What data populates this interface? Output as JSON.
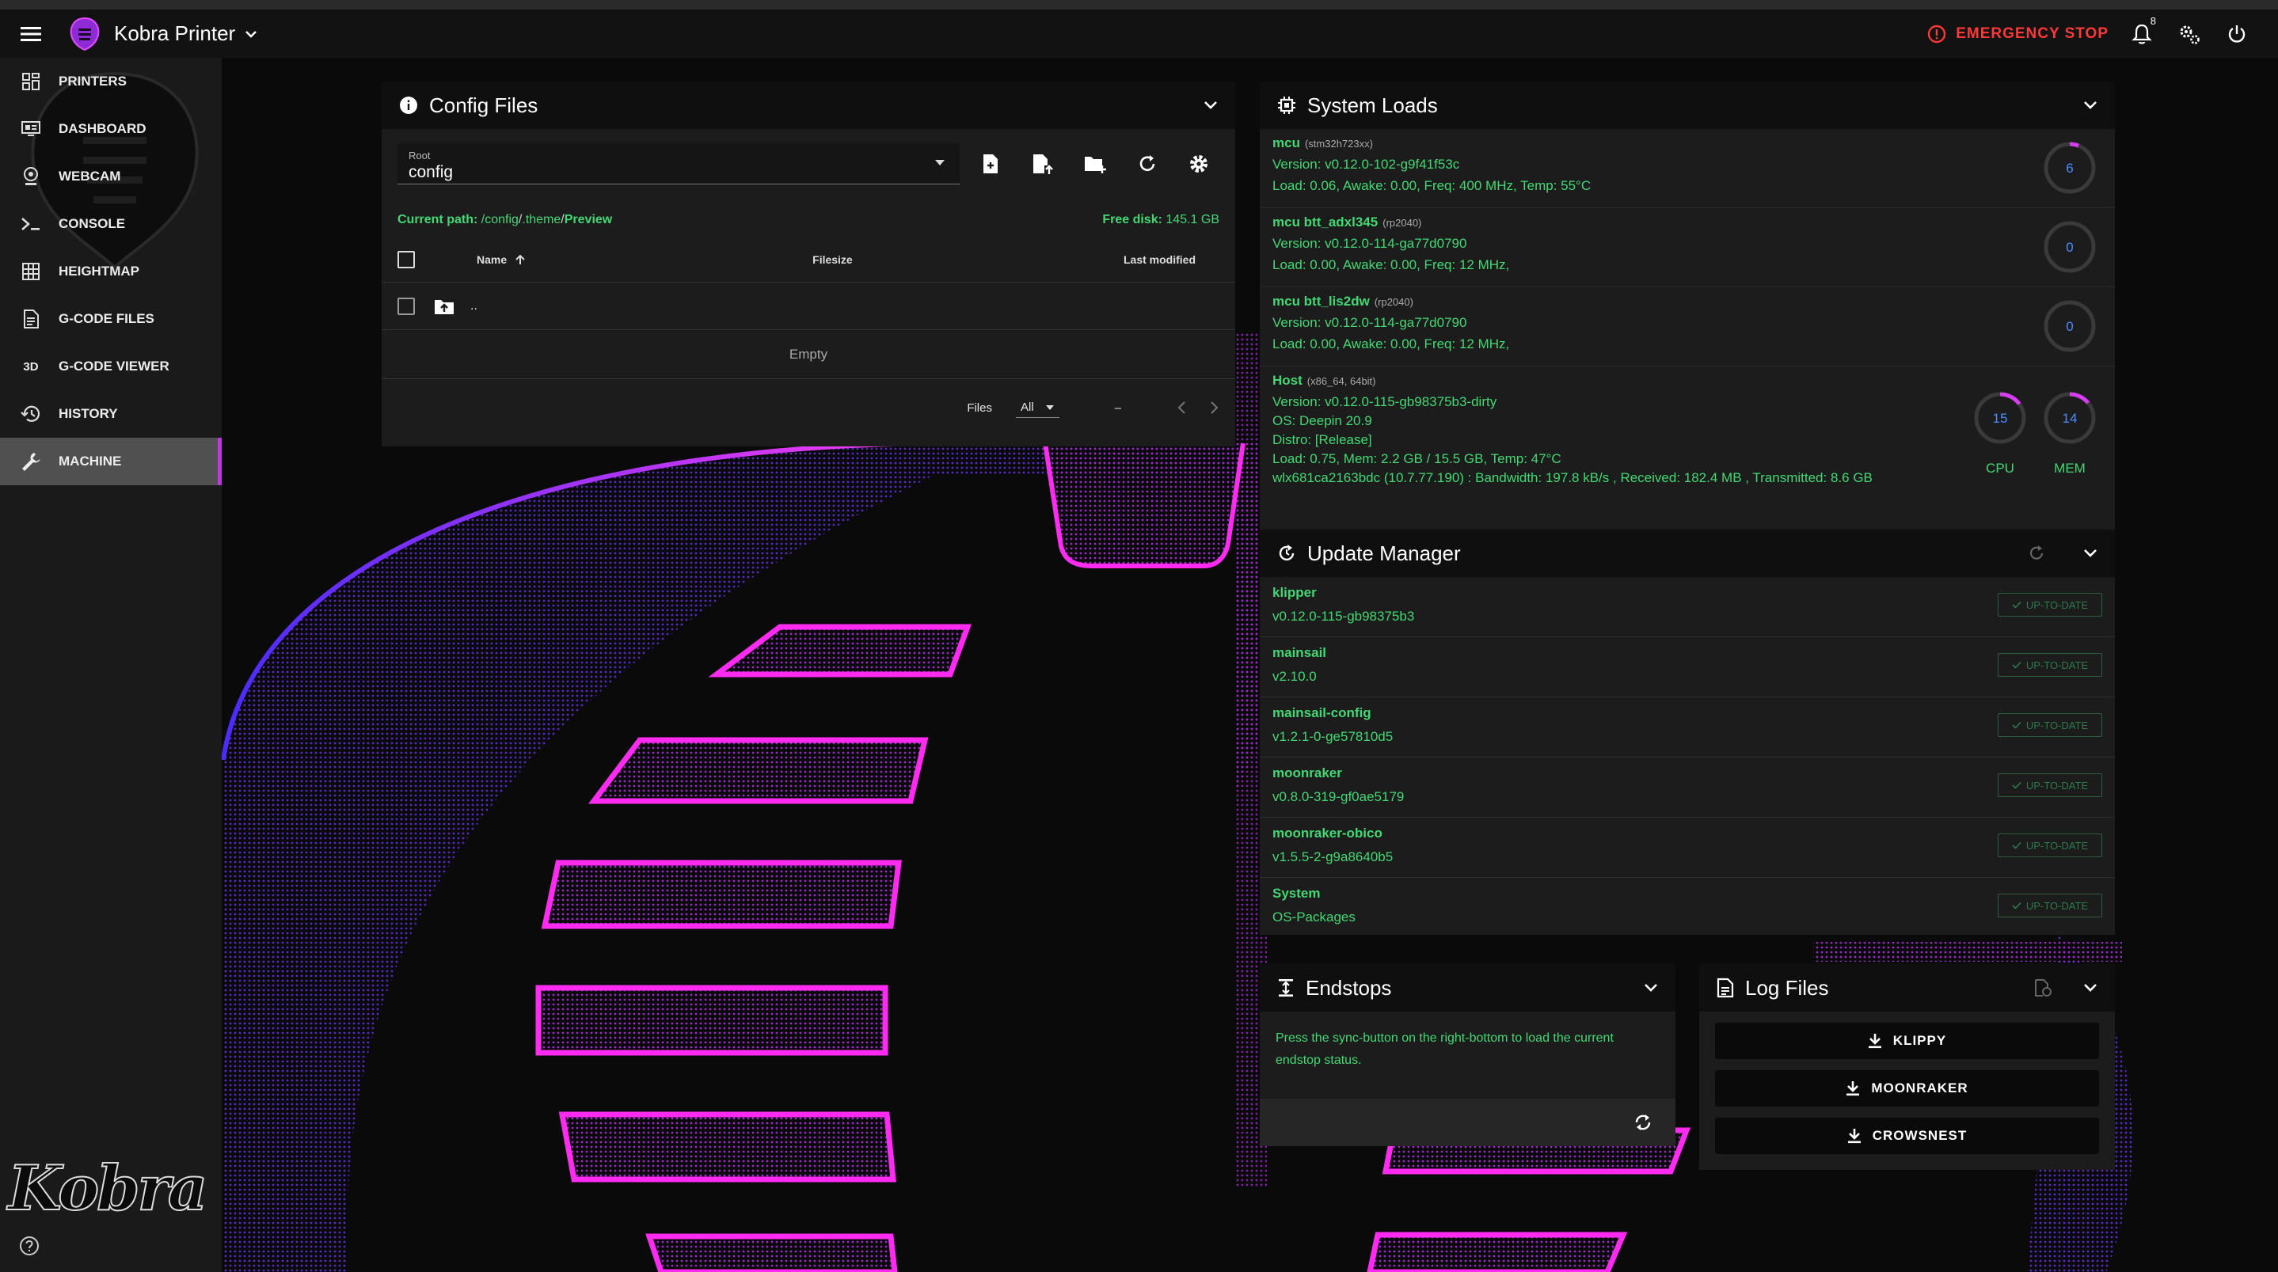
{
  "app": {
    "title": "Kobra Printer"
  },
  "topbar": {
    "emergency_stop": "EMERGENCY STOP",
    "notifications_count": "8"
  },
  "sidebar": {
    "items": [
      {
        "label": "PRINTERS",
        "icon": "grid-icon"
      },
      {
        "label": "DASHBOARD",
        "icon": "dashboard-icon"
      },
      {
        "label": "WEBCAM",
        "icon": "webcam-icon"
      },
      {
        "label": "CONSOLE",
        "icon": "console-icon"
      },
      {
        "label": "HEIGHTMAP",
        "icon": "heightmap-icon"
      },
      {
        "label": "G-CODE FILES",
        "icon": "file-icon"
      },
      {
        "label": "G-CODE VIEWER",
        "icon": "3d-icon"
      },
      {
        "label": "HISTORY",
        "icon": "history-icon"
      },
      {
        "label": "MACHINE",
        "icon": "wrench-icon"
      }
    ],
    "brand": "Kobra",
    "icon_3d": "3D"
  },
  "config_files": {
    "title": "Config Files",
    "root_label": "Root",
    "root_value": "config",
    "current_path_label": "Current path:",
    "path_part1": "/config",
    "path_sep1": "/",
    "path_part2": ".theme",
    "path_sep2": "/",
    "path_part3": "Preview",
    "free_disk_label": "Free disk:",
    "free_disk_value": "145.1 GB",
    "columns": {
      "name": "Name",
      "filesize": "Filesize",
      "last_modified": "Last modified"
    },
    "up_dir": "..",
    "empty": "Empty",
    "footer": {
      "files_label": "Files",
      "per_page": "All",
      "range": "–"
    }
  },
  "system_loads": {
    "title": "System Loads",
    "mcus": [
      {
        "name": "mcu",
        "chip": "(stm32h723xx)",
        "version": "Version: v0.12.0-102-g9f41f53c",
        "load": "Load: 0.06, Awake: 0.00, Freq: 400 MHz, Temp: 55°C",
        "gauge": "6",
        "gauge_pct": 6
      },
      {
        "name": "mcu btt_adxl345",
        "chip": "(rp2040)",
        "version": "Version: v0.12.0-114-ga77d0790",
        "load": "Load: 0.00, Awake: 0.00, Freq: 12 MHz,",
        "gauge": "0",
        "gauge_pct": 0
      },
      {
        "name": "mcu btt_lis2dw",
        "chip": "(rp2040)",
        "version": "Version: v0.12.0-114-ga77d0790",
        "load": "Load: 0.00, Awake: 0.00, Freq: 12 MHz,",
        "gauge": "0",
        "gauge_pct": 0
      }
    ],
    "host": {
      "name": "Host",
      "chip": "(x86_64, 64bit)",
      "version": "Version: v0.12.0-115-gb98375b3-dirty",
      "os": "OS: Deepin 20.9",
      "distro": "Distro: [Release]",
      "load": "Load: 0.75, Mem: 2.2 GB / 15.5 GB, Temp: 47°C",
      "network": "wlx681ca2163bdc (10.7.77.190) : Bandwidth: 197.8 kB/s , Received: 182.4 MB , Transmitted: 8.6 GB",
      "cpu": "15",
      "cpu_pct": 15,
      "cpu_label": "CPU",
      "mem": "14",
      "mem_pct": 14,
      "mem_label": "MEM"
    }
  },
  "update_manager": {
    "title": "Update Manager",
    "status_label": "UP-TO-DATE",
    "items": [
      {
        "name": "klipper",
        "version": "v0.12.0-115-gb98375b3"
      },
      {
        "name": "mainsail",
        "version": "v2.10.0"
      },
      {
        "name": "mainsail-config",
        "version": "v1.2.1-0-ge57810d5"
      },
      {
        "name": "moonraker",
        "version": "v0.8.0-319-gf0ae5179"
      },
      {
        "name": "moonraker-obico",
        "version": "v1.5.5-2-g9a8640b5"
      },
      {
        "name": "System",
        "version": "OS-Packages"
      }
    ]
  },
  "endstops": {
    "title": "Endstops",
    "message": "Press the sync-button on the right-bottom to load the current endstop status."
  },
  "log_files": {
    "title": "Log Files",
    "buttons": [
      "KLIPPY",
      "MOONRAKER",
      "CROWSNEST"
    ]
  },
  "colors": {
    "accent": "#c234e8",
    "green": "#43d873",
    "estop": "#ff3838"
  }
}
